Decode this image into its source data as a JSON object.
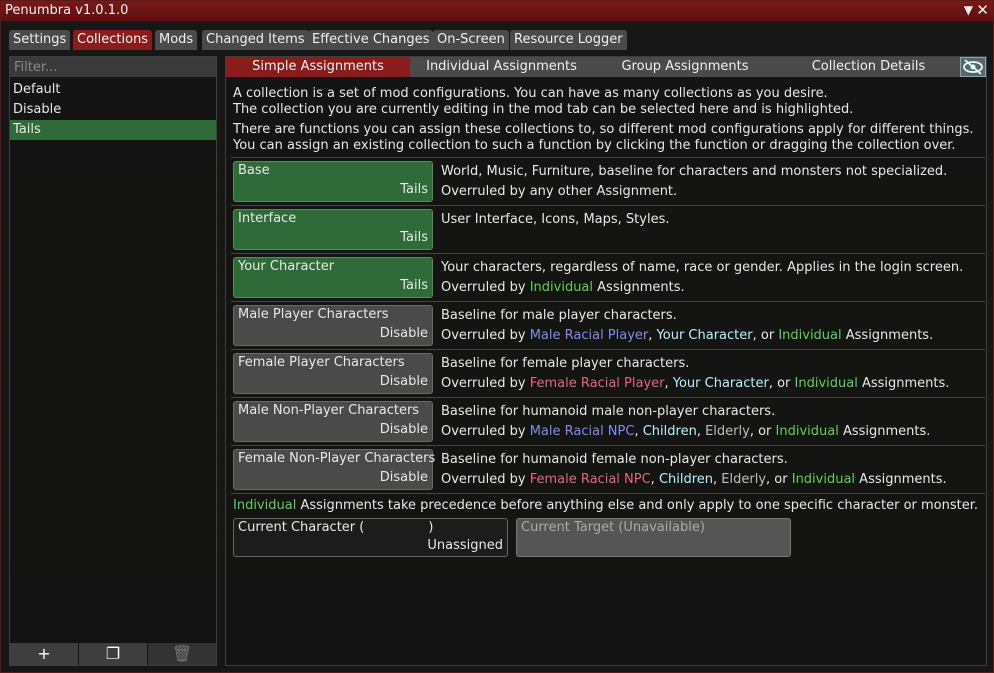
{
  "window": {
    "title": "Penumbra v1.0.1.0",
    "collapse_icon": "triangle-down-icon",
    "close_icon": "close-icon"
  },
  "tabs": [
    "Settings",
    "Collections",
    "Mods",
    "Changed Items",
    "Effective Changes",
    "On-Screen",
    "Resource Logger"
  ],
  "active_tab": "Collections",
  "left": {
    "filter_placeholder": "Filter...",
    "collections": [
      "Default",
      "Disable",
      "Tails"
    ],
    "selected": "Tails",
    "buttons": [
      {
        "icon": "plus-icon",
        "glyph": "+"
      },
      {
        "icon": "duplicate-icon",
        "glyph": "❐"
      },
      {
        "icon": "trash-icon",
        "glyph": "🗑"
      }
    ]
  },
  "subtabs": [
    "Simple Assignments",
    "Individual Assignments",
    "Group Assignments",
    "Collection Details"
  ],
  "active_subtab": "Simple Assignments",
  "eye_icon": "hidden-eye-icon",
  "intro": [
    "A collection is a set of mod configurations. You can have as many collections as you desire.",
    "The collection you are currently editing in the mod tab can be selected here and is highlighted.",
    "There are functions you can assign these collections to, so different mod configurations apply for different things.",
    "You can assign an existing collection to such a function by clicking the function or dragging the collection over."
  ],
  "assignments": [
    {
      "name": "Base",
      "value": "Tails",
      "line1": "World, Music, Furniture, baseline for characters and monsters not specialized.",
      "line2_prefix": "Overruled by any other Assignment.",
      "line2_parts": []
    },
    {
      "name": "Interface",
      "value": "Tails",
      "line1": "User Interface, Icons, Maps, Styles.",
      "line2_prefix": "",
      "line2_parts": []
    },
    {
      "name": "Your Character",
      "value": "Tails",
      "line1": "Your characters, regardless of name, race or gender. Applies in the login screen.",
      "line2_prefix": "Overruled by ",
      "line2_parts": [
        [
          "Individual",
          "green"
        ],
        [
          " Assignments.",
          ""
        ]
      ]
    },
    {
      "name": "Male Player Characters",
      "value": "Disable",
      "line1": "Baseline for male player characters.",
      "line2_prefix": "Overruled by ",
      "line2_parts": [
        [
          "Male Racial Player",
          "blue"
        ],
        [
          ", ",
          ""
        ],
        [
          "Your Character",
          "cyan"
        ],
        [
          ", or ",
          ""
        ],
        [
          "Individual",
          "green"
        ],
        [
          " Assignments.",
          ""
        ]
      ]
    },
    {
      "name": "Female Player Characters",
      "value": "Disable",
      "line1": "Baseline for female player characters.",
      "line2_prefix": "Overruled by ",
      "line2_parts": [
        [
          "Female Racial Player",
          "red"
        ],
        [
          ", ",
          ""
        ],
        [
          "Your Character",
          "cyan"
        ],
        [
          ", or ",
          ""
        ],
        [
          "Individual",
          "green"
        ],
        [
          " Assignments.",
          ""
        ]
      ]
    },
    {
      "name": "Male Non-Player Characters",
      "value": "Disable",
      "line1": "Baseline for humanoid male non-player characters.",
      "line2_prefix": "Overruled by ",
      "line2_parts": [
        [
          "Male Racial NPC",
          "blue"
        ],
        [
          ", ",
          ""
        ],
        [
          "Children",
          "cyan"
        ],
        [
          ", ",
          ""
        ],
        [
          "Elderly",
          "gray"
        ],
        [
          ", or ",
          ""
        ],
        [
          "Individual",
          "green"
        ],
        [
          " Assignments.",
          ""
        ]
      ]
    },
    {
      "name": "Female Non-Player Characters",
      "value": "Disable",
      "line1": "Baseline for humanoid female non-player characters.",
      "line2_prefix": "Overruled by ",
      "line2_parts": [
        [
          "Female Racial NPC",
          "red"
        ],
        [
          ", ",
          ""
        ],
        [
          "Children",
          "cyan"
        ],
        [
          ", ",
          ""
        ],
        [
          "Elderly",
          "gray"
        ],
        [
          ", or ",
          ""
        ],
        [
          "Individual",
          "green"
        ],
        [
          " Assignments.",
          ""
        ]
      ]
    }
  ],
  "individual_note": {
    "highlight": "Individual",
    "rest": " Assignments take precedence before anything else and only apply to one specific character or monster."
  },
  "current_character": {
    "label": "Current Character (",
    "close": ")",
    "value": "Unassigned"
  },
  "current_target": {
    "label": "Current Target (Unavailable)"
  },
  "colors": {
    "accent_red": "#8a1c1c",
    "selected_green": "#2f6b38",
    "blue": "#7f8fe8",
    "green": "#5ed05e",
    "red": "#e06a7a",
    "cyan": "#b8f0ff"
  }
}
